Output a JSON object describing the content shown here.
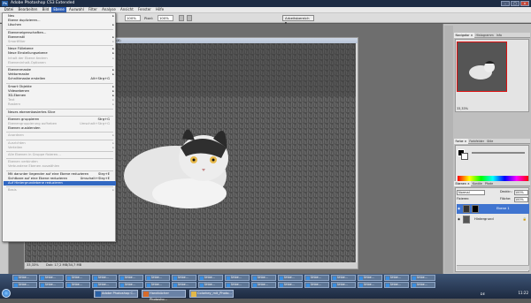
{
  "window": {
    "title": "Adobe Photoshop CS3 Extended",
    "app_icon": "Ps"
  },
  "menubar": [
    "Datei",
    "Bearbeiten",
    "Bild",
    "Ebene",
    "Auswahl",
    "Filter",
    "Analyse",
    "Ansicht",
    "Fenster",
    "Hilfe"
  ],
  "options": {
    "zoom1": "100%",
    "px_label": "Pixel:",
    "zoom2": "100%",
    "workspace": "Arbeitsbereich ▾"
  },
  "doc": {
    "title": "...ente(8)",
    "zoom": "33,33%",
    "status": "Dok: 17,2 MB/34,7 MB"
  },
  "layer_menu": [
    {
      "label": "Neu",
      "arrow": true
    },
    {
      "label": "Ebene duplizieren..."
    },
    {
      "label": "Löschen",
      "arrow": true
    },
    {
      "sep": true
    },
    {
      "label": "Ebeneneigenschaften..."
    },
    {
      "label": "Ebenenstil",
      "arrow": true
    },
    {
      "label": "Smartfilter",
      "disabled": true,
      "arrow": true
    },
    {
      "sep": true
    },
    {
      "label": "Neue Füllebene",
      "arrow": true
    },
    {
      "label": "Neue Einstellungsebene",
      "arrow": true
    },
    {
      "label": "Inhalt der Ebene ändern",
      "disabled": true,
      "arrow": true
    },
    {
      "label": "Ebeneninhalt-Optionen",
      "disabled": true
    },
    {
      "sep": true
    },
    {
      "label": "Ebenenmaske",
      "arrow": true
    },
    {
      "label": "Vektormaske",
      "arrow": true
    },
    {
      "label": "Schnittmaske erstellen",
      "shortcut": "Alt+Strg+G"
    },
    {
      "sep": true
    },
    {
      "label": "Smart Objekte",
      "arrow": true
    },
    {
      "label": "Videoebenen",
      "arrow": true
    },
    {
      "label": "3D-Ebenen",
      "arrow": true
    },
    {
      "label": "Text",
      "disabled": true,
      "arrow": true
    },
    {
      "label": "Rastern",
      "disabled": true,
      "arrow": true
    },
    {
      "sep": true
    },
    {
      "label": "Neues ebenenbasiertes Slice"
    },
    {
      "sep": true
    },
    {
      "label": "Ebenen gruppieren",
      "shortcut": "Strg+G"
    },
    {
      "label": "Ebenengruppierung aufheben",
      "disabled": true,
      "shortcut": "Umschalt+Strg+G"
    },
    {
      "label": "Ebenen ausblenden"
    },
    {
      "sep": true
    },
    {
      "label": "Anordnen",
      "disabled": true,
      "arrow": true
    },
    {
      "sep": true
    },
    {
      "label": "Ausrichten",
      "disabled": true,
      "arrow": true
    },
    {
      "label": "Verteilen",
      "disabled": true,
      "arrow": true
    },
    {
      "sep": true
    },
    {
      "label": "Alle Ebenen in Gruppe fixieren...",
      "disabled": true
    },
    {
      "sep": true
    },
    {
      "label": "Ebenen verbinden",
      "disabled": true
    },
    {
      "label": "Verbundene Ebenen auswählen",
      "disabled": true
    },
    {
      "sep": true
    },
    {
      "label": "Mit darunter liegender auf eine Ebene reduzieren",
      "shortcut": "Strg+E"
    },
    {
      "label": "Sichtbare auf eine Ebene reduzieren",
      "shortcut": "Umschalt+Strg+E"
    },
    {
      "label": "Auf Hintergrundebene reduzieren",
      "selected": true
    },
    {
      "sep": true
    },
    {
      "label": "Basis",
      "disabled": true,
      "arrow": true
    }
  ],
  "panels": {
    "nav_tabs": [
      "Navigator ×",
      "Histogramm",
      "Info"
    ],
    "nav_zoom": "33,33%",
    "color_tabs": [
      "Farbe ×",
      "Farbfelder",
      "Stile"
    ],
    "layer_tabs": [
      "Ebenen ×",
      "Kanäle",
      "Pfade"
    ],
    "blend": "Normal",
    "opacity_label": "Deckkr.:",
    "opacity": "100%",
    "fix_label": "Fixieren:",
    "fill_label": "Fläche:",
    "fill": "100%",
    "layers": [
      {
        "name": "Ebene 1",
        "active": true
      },
      {
        "name": "Hintergrund",
        "active": false
      }
    ]
  },
  "taskbar": {
    "row1": [
      "Unbe...",
      "Unbe...",
      "Unbe...",
      "Unbe...",
      "Unbe...",
      "Unbe...",
      "Unbe...",
      "Unbe...",
      "Unbe...",
      "Unbe...",
      "Unbe...",
      "Unbe...",
      "Unbe...",
      "Unbe...",
      "Unbe...",
      "Unbe..."
    ],
    "row2": [
      "Unbe...",
      "Unbe...",
      "Unbe...",
      "Unbe...",
      "Unbe...",
      "Unbe...",
      "Unbe...",
      "Unbe...",
      "Unbe...",
      "Unbe...",
      "Unbe...",
      "Unbe...",
      "Unbe...",
      "Unbe...",
      "Unbe...",
      "Unbe..."
    ],
    "apps": [
      "Adobe Photoshop C...",
      "Handbücher Photosho...",
      "Colorkey_mit_Photo..."
    ],
    "lang": "DE",
    "clock": "11:22"
  }
}
